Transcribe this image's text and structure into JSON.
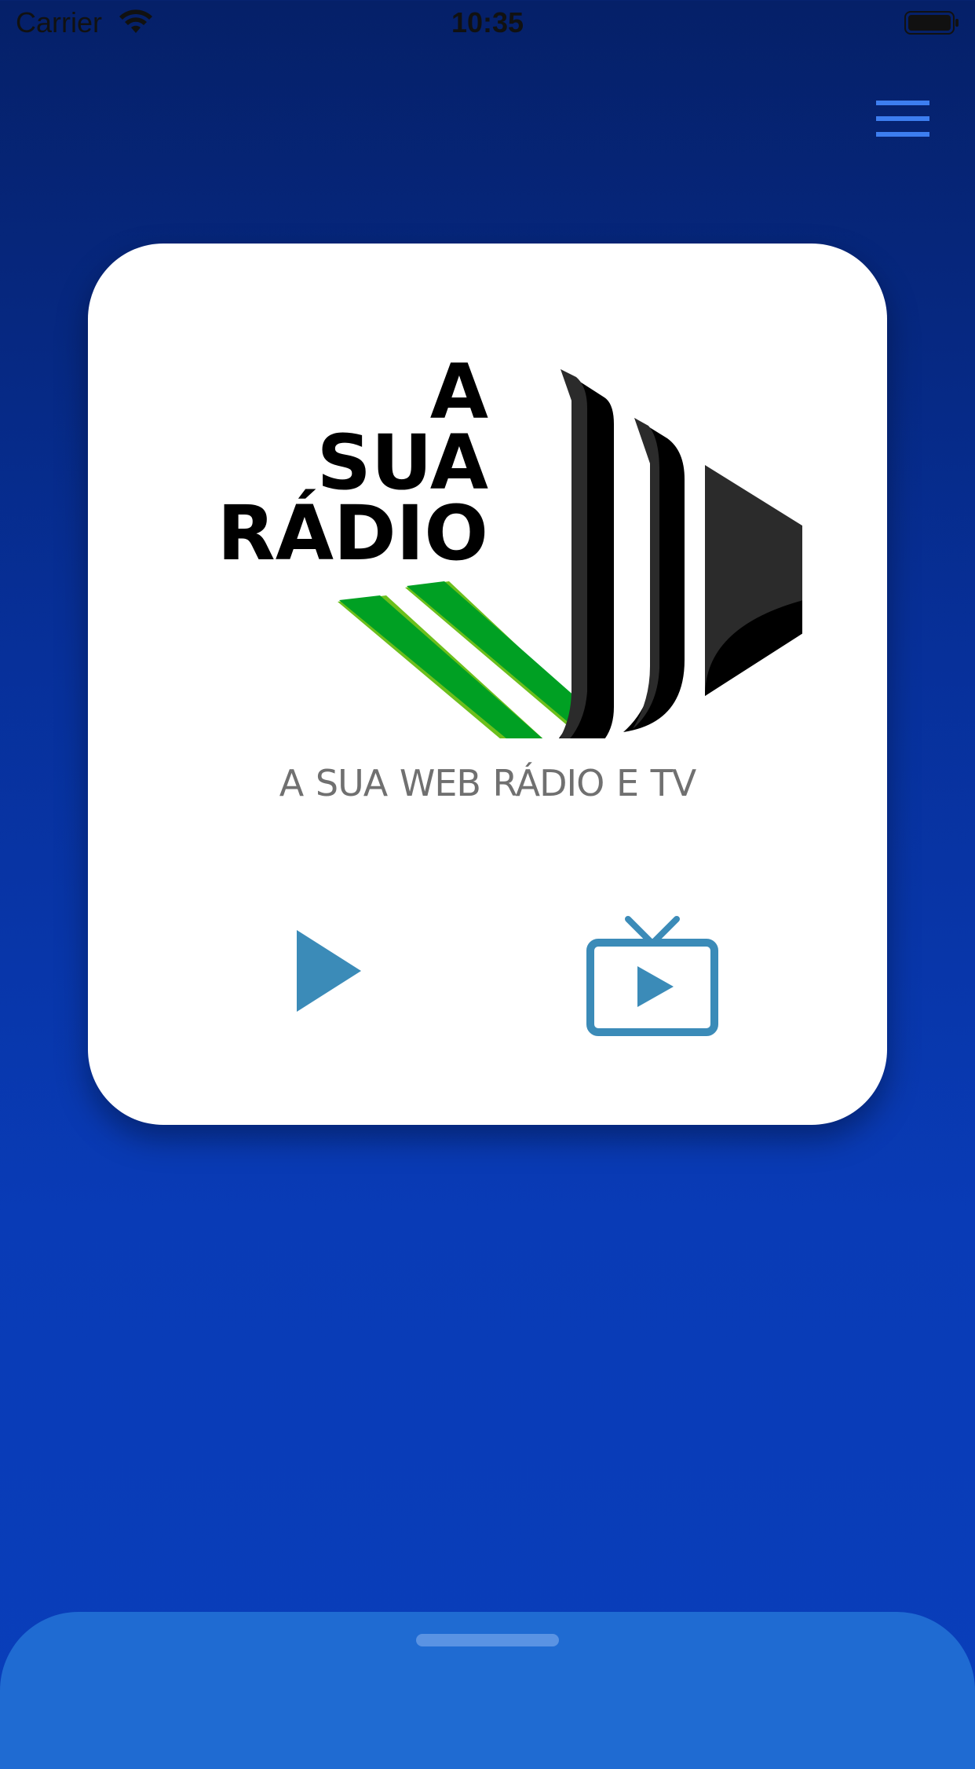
{
  "status_bar": {
    "carrier": "Carrier",
    "time": "10:35",
    "wifi_icon": "wifi-icon",
    "battery_icon": "battery-icon"
  },
  "header": {
    "menu_icon": "hamburger-menu-icon",
    "menu_color": "#3d7ef0"
  },
  "card": {
    "logo": {
      "line1": "A",
      "line2": "SUA",
      "line3": "RÁDIO"
    },
    "tagline": "A SUA WEB RÁDIO  E  TV",
    "play_icon": "play-icon",
    "tv_icon": "tv-play-icon",
    "accent_color": "#3b8bb8"
  },
  "colors": {
    "background_top": "#052068",
    "background_bottom": "#093eba",
    "sheet": "#1f6bd2",
    "logo_green": "#00a023"
  }
}
